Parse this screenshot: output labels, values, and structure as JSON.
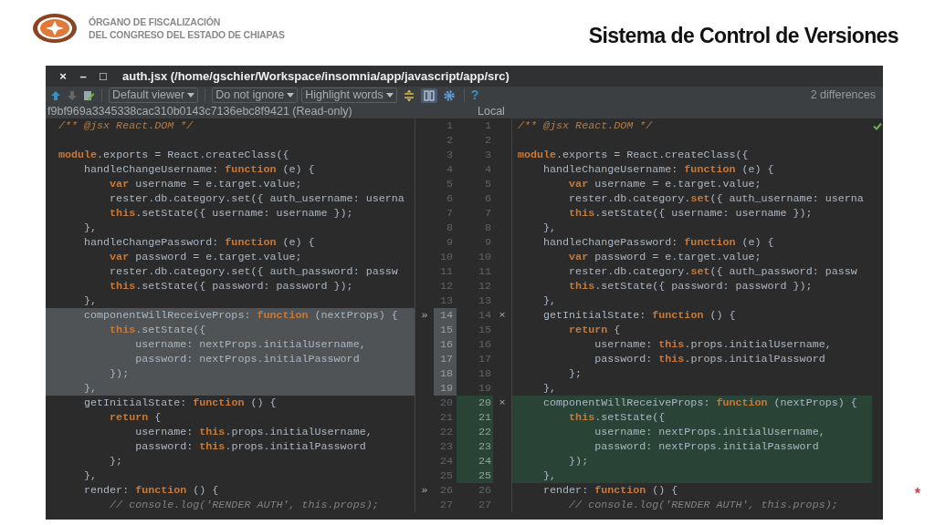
{
  "slide": {
    "org_name": [
      "ÓRGANO DE FISCALIZACIÓN",
      "DEL CONGRESO DEL ESTADO DE CHIAPAS"
    ],
    "title": "Sistema de Control de Versiones",
    "footnote_mark": "*"
  },
  "window": {
    "controls": [
      "×",
      "–",
      "□"
    ],
    "title": "auth.jsx (/home/gschier/Workspace/insomnia/app/javascript/app/src)"
  },
  "toolbar": {
    "buttons": [
      {
        "kind": "arrow-up",
        "disabled": false
      },
      {
        "kind": "arrow-down",
        "disabled": true
      },
      {
        "kind": "edit",
        "disabled": false
      }
    ],
    "dropdowns": [
      {
        "label": "Default viewer"
      },
      {
        "label": "Do not ignore"
      },
      {
        "label": "Highlight words"
      }
    ],
    "toggles": [
      {
        "kind": "sync-scroll",
        "selected": false
      },
      {
        "kind": "side-by-side",
        "selected": true
      },
      {
        "kind": "settings",
        "selected": false
      }
    ],
    "help": "?",
    "status": "2 differences"
  },
  "diff": {
    "left_header": "f9bf969a3345338cac310b0143c7136ebc8f9421 (Read-only)",
    "right_header": "Local",
    "in_sync": true,
    "rows": [
      {
        "left": {
          "number": "1",
          "changed": false,
          "tokens": [
            {
              "kind": "doc",
              "text": "/** @jsx React.DOM */"
            }
          ]
        },
        "right": {
          "number": "1",
          "changed": false,
          "tokens": [
            {
              "kind": "doc",
              "text": "/** @jsx React.DOM */"
            }
          ]
        }
      },
      {
        "left": {
          "number": "2",
          "changed": false
        },
        "right": {
          "number": "2",
          "changed": false
        }
      },
      {
        "left": {
          "number": "3",
          "changed": false,
          "tokens": [
            {
              "kind": "keyword",
              "text": "module"
            },
            {
              "kind": "plain",
              "text": ".exports = React.createClass({"
            }
          ]
        },
        "right": {
          "number": "3",
          "changed": false,
          "tokens": [
            {
              "kind": "keyword",
              "text": "module"
            },
            {
              "kind": "plain",
              "text": ".exports = React.createClass({"
            }
          ]
        }
      },
      {
        "left": {
          "number": "4",
          "changed": false,
          "tokens": [
            {
              "kind": "plain",
              "text": "    handleChangeUsername: "
            },
            {
              "kind": "keyword",
              "text": "function"
            },
            {
              "kind": "plain",
              "text": " (e) {"
            }
          ]
        },
        "right": {
          "number": "4",
          "changed": false,
          "tokens": [
            {
              "kind": "plain",
              "text": "    handleChangeUsername: "
            },
            {
              "kind": "keyword",
              "text": "function"
            },
            {
              "kind": "plain",
              "text": " (e) {"
            }
          ]
        }
      },
      {
        "left": {
          "number": "5",
          "changed": false,
          "tokens": [
            {
              "kind": "keyword",
              "text": "        var"
            },
            {
              "kind": "plain",
              "text": " username = e.target.value;"
            }
          ]
        },
        "right": {
          "number": "5",
          "changed": false,
          "tokens": [
            {
              "kind": "keyword",
              "text": "        var"
            },
            {
              "kind": "plain",
              "text": " username = e.target.value;"
            }
          ]
        }
      },
      {
        "left": {
          "number": "6",
          "changed": false,
          "tokens": [
            {
              "kind": "plain",
              "text": "        rester.db.category.set({ auth_username: userna"
            }
          ]
        },
        "right": {
          "number": "6",
          "changed": false,
          "tokens": [
            {
              "kind": "plain",
              "text": "        rester.db.category."
            },
            {
              "kind": "keyword",
              "text": "set"
            },
            {
              "kind": "plain",
              "text": "({ auth_username: userna"
            }
          ]
        }
      },
      {
        "left": {
          "number": "7",
          "changed": false,
          "tokens": [
            {
              "kind": "keyword",
              "text": "        this"
            },
            {
              "kind": "plain",
              "text": ".setState({ username: username });"
            }
          ]
        },
        "right": {
          "number": "7",
          "changed": false,
          "tokens": [
            {
              "kind": "keyword",
              "text": "        this"
            },
            {
              "kind": "plain",
              "text": ".setState({ username: username });"
            }
          ]
        }
      },
      {
        "left": {
          "number": "8",
          "changed": false,
          "tokens": [
            {
              "kind": "plain",
              "text": "    },"
            }
          ]
        },
        "right": {
          "number": "8",
          "changed": false,
          "tokens": [
            {
              "kind": "plain",
              "text": "    },"
            }
          ]
        }
      },
      {
        "left": {
          "number": "9",
          "changed": false,
          "tokens": [
            {
              "kind": "plain",
              "text": "    handleChangePassword: "
            },
            {
              "kind": "keyword",
              "text": "function"
            },
            {
              "kind": "plain",
              "text": " (e) {"
            }
          ]
        },
        "right": {
          "number": "9",
          "changed": false,
          "tokens": [
            {
              "kind": "plain",
              "text": "    handleChangePassword: "
            },
            {
              "kind": "keyword",
              "text": "function"
            },
            {
              "kind": "plain",
              "text": " (e) {"
            }
          ]
        }
      },
      {
        "left": {
          "number": "10",
          "changed": false,
          "tokens": [
            {
              "kind": "keyword",
              "text": "        var"
            },
            {
              "kind": "plain",
              "text": " password = e.target.value;"
            }
          ]
        },
        "right": {
          "number": "10",
          "changed": false,
          "tokens": [
            {
              "kind": "keyword",
              "text": "        var"
            },
            {
              "kind": "plain",
              "text": " password = e.target.value;"
            }
          ]
        }
      },
      {
        "left": {
          "number": "11",
          "changed": false,
          "tokens": [
            {
              "kind": "plain",
              "text": "        rester.db.category.set({ auth_password: passw"
            }
          ]
        },
        "right": {
          "number": "11",
          "changed": false,
          "tokens": [
            {
              "kind": "plain",
              "text": "        rester.db.category."
            },
            {
              "kind": "keyword",
              "text": "set"
            },
            {
              "kind": "plain",
              "text": "({ auth_password: passw"
            }
          ]
        }
      },
      {
        "left": {
          "number": "12",
          "changed": false,
          "tokens": [
            {
              "kind": "keyword",
              "text": "        this"
            },
            {
              "kind": "plain",
              "text": ".setState({ password: password });"
            }
          ]
        },
        "right": {
          "number": "12",
          "changed": false,
          "tokens": [
            {
              "kind": "keyword",
              "text": "        this"
            },
            {
              "kind": "plain",
              "text": ".setState({ password: password });"
            }
          ]
        }
      },
      {
        "left": {
          "number": "13",
          "changed": false,
          "tokens": [
            {
              "kind": "plain",
              "text": "    },"
            }
          ]
        },
        "right": {
          "number": "13",
          "changed": false,
          "tokens": [
            {
              "kind": "plain",
              "text": "    },"
            }
          ]
        }
      },
      {
        "left": {
          "number": "14",
          "changed": true,
          "action": "»",
          "tokens": [
            {
              "kind": "plain",
              "text": "    componentWillReceiveProps: "
            },
            {
              "kind": "keyword",
              "text": "function"
            },
            {
              "kind": "plain",
              "text": " (nextProps) {"
            }
          ]
        },
        "right": {
          "number": "14",
          "changed": false,
          "action": "×",
          "tokens": [
            {
              "kind": "plain",
              "text": "    getInitialState: "
            },
            {
              "kind": "keyword",
              "text": "function"
            },
            {
              "kind": "plain",
              "text": " () {"
            }
          ]
        }
      },
      {
        "left": {
          "number": "15",
          "changed": true,
          "tokens": [
            {
              "kind": "keyword",
              "text": "        this"
            },
            {
              "kind": "plain",
              "text": ".setState({"
            }
          ]
        },
        "right": {
          "number": "15",
          "changed": false,
          "tokens": [
            {
              "kind": "keyword",
              "text": "        return"
            },
            {
              "kind": "plain",
              "text": " {"
            }
          ]
        }
      },
      {
        "left": {
          "number": "16",
          "changed": true,
          "tokens": [
            {
              "kind": "plain",
              "text": "            username: nextProps.initialUsername,"
            }
          ]
        },
        "right": {
          "number": "16",
          "changed": false,
          "tokens": [
            {
              "kind": "plain",
              "text": "            username: "
            },
            {
              "kind": "keyword",
              "text": "this"
            },
            {
              "kind": "plain",
              "text": ".props.initialUsername,"
            }
          ]
        }
      },
      {
        "left": {
          "number": "17",
          "changed": true,
          "tokens": [
            {
              "kind": "plain",
              "text": "            password: nextProps.initialPassword"
            }
          ]
        },
        "right": {
          "number": "17",
          "changed": false,
          "tokens": [
            {
              "kind": "plain",
              "text": "            password: "
            },
            {
              "kind": "keyword",
              "text": "this"
            },
            {
              "kind": "plain",
              "text": ".props.initialPassword"
            }
          ]
        }
      },
      {
        "left": {
          "number": "18",
          "changed": true,
          "tokens": [
            {
              "kind": "plain",
              "text": "        });"
            }
          ]
        },
        "right": {
          "number": "18",
          "changed": false,
          "tokens": [
            {
              "kind": "plain",
              "text": "        };"
            }
          ]
        }
      },
      {
        "left": {
          "number": "19",
          "changed": true,
          "tokens": [
            {
              "kind": "plain",
              "text": "    },"
            }
          ]
        },
        "right": {
          "number": "19",
          "changed": false,
          "tokens": [
            {
              "kind": "plain",
              "text": "    },"
            }
          ]
        }
      },
      {
        "left": {
          "number": "20",
          "changed": false,
          "tokens": [
            {
              "kind": "plain",
              "text": "    getInitialState: "
            },
            {
              "kind": "keyword",
              "text": "function"
            },
            {
              "kind": "plain",
              "text": " () {"
            }
          ]
        },
        "right": {
          "number": "20",
          "changed": true,
          "action": "×",
          "tokens": [
            {
              "kind": "plain",
              "text": "    componentWillReceiveProps: "
            },
            {
              "kind": "keyword",
              "text": "function"
            },
            {
              "kind": "plain",
              "text": " (nextProps) {"
            }
          ]
        }
      },
      {
        "left": {
          "number": "21",
          "changed": false,
          "tokens": [
            {
              "kind": "keyword",
              "text": "        return"
            },
            {
              "kind": "plain",
              "text": " {"
            }
          ]
        },
        "right": {
          "number": "21",
          "changed": true,
          "tokens": [
            {
              "kind": "keyword",
              "text": "        this"
            },
            {
              "kind": "plain",
              "text": ".setState({"
            }
          ]
        }
      },
      {
        "left": {
          "number": "22",
          "changed": false,
          "tokens": [
            {
              "kind": "plain",
              "text": "            username: "
            },
            {
              "kind": "keyword",
              "text": "this"
            },
            {
              "kind": "plain",
              "text": ".props.initialUsername,"
            }
          ]
        },
        "right": {
          "number": "22",
          "changed": true,
          "tokens": [
            {
              "kind": "plain",
              "text": "            username: nextProps.initialUsername,"
            }
          ]
        }
      },
      {
        "left": {
          "number": "23",
          "changed": false,
          "tokens": [
            {
              "kind": "plain",
              "text": "            password: "
            },
            {
              "kind": "keyword",
              "text": "this"
            },
            {
              "kind": "plain",
              "text": ".props.initialPassword"
            }
          ]
        },
        "right": {
          "number": "23",
          "changed": true,
          "tokens": [
            {
              "kind": "plain",
              "text": "            password: nextProps.initialPassword"
            }
          ]
        }
      },
      {
        "left": {
          "number": "24",
          "changed": false,
          "tokens": [
            {
              "kind": "plain",
              "text": "        };"
            }
          ]
        },
        "right": {
          "number": "24",
          "changed": true,
          "tokens": [
            {
              "kind": "plain",
              "text": "        });"
            }
          ]
        }
      },
      {
        "left": {
          "number": "25",
          "changed": false,
          "tokens": [
            {
              "kind": "plain",
              "text": "    },"
            }
          ]
        },
        "right": {
          "number": "25",
          "changed": true,
          "tokens": [
            {
              "kind": "plain",
              "text": "    },"
            }
          ]
        }
      },
      {
        "left": {
          "number": "26",
          "changed": false,
          "action": "»",
          "tokens": [
            {
              "kind": "plain",
              "text": "    render: "
            },
            {
              "kind": "keyword",
              "text": "function"
            },
            {
              "kind": "plain",
              "text": " () {"
            }
          ]
        },
        "right": {
          "number": "26",
          "changed": false,
          "tokens": [
            {
              "kind": "plain",
              "text": "    render: "
            },
            {
              "kind": "keyword",
              "text": "function"
            },
            {
              "kind": "plain",
              "text": " () {"
            }
          ]
        }
      },
      {
        "left": {
          "number": "27",
          "changed": false,
          "tokens": [
            {
              "kind": "comment",
              "text": "        // console.log('RENDER AUTH', this.props);"
            }
          ]
        },
        "right": {
          "number": "27",
          "changed": false,
          "tokens": [
            {
              "kind": "comment",
              "text": "        // console.log('RENDER AUTH', this.props);"
            }
          ]
        }
      }
    ]
  }
}
